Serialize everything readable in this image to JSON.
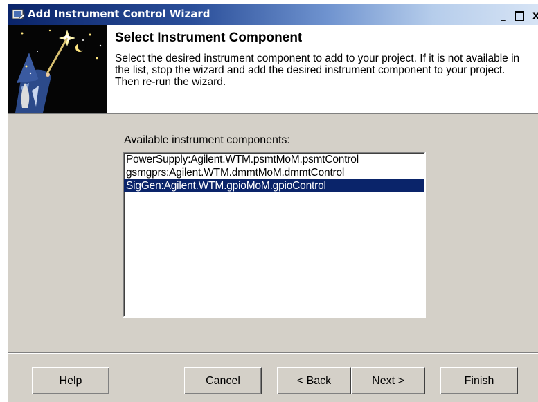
{
  "window": {
    "title": "Add Instrument Control Wizard",
    "minimize_glyph": "_",
    "close_glyph": "x"
  },
  "header": {
    "title": "Select Instrument Component",
    "description": "Select the desired instrument component to add to your project.  If it is not available in the list, stop the wizard and add the desired instrument component to your project. Then re-run the wizard.",
    "art_icon": "wizard-with-wand-icon"
  },
  "main": {
    "list_label": "Available instrument components:",
    "components": [
      "PowerSupply:Agilent.WTM.psmtMoM.psmtControl",
      "gsmgprs:Agilent.WTM.dmmtMoM.dmmtControl",
      "SigGen:Agilent.WTM.gpioMoM.gpioControl"
    ],
    "selected_index": 2
  },
  "footer": {
    "help": "Help",
    "cancel": "Cancel",
    "back": "< Back",
    "next": "Next >",
    "finish": "Finish"
  },
  "colors": {
    "selection": "#0a246a",
    "dialog_face": "#d4d0c8",
    "title_gradient_start": "#0a246a"
  }
}
